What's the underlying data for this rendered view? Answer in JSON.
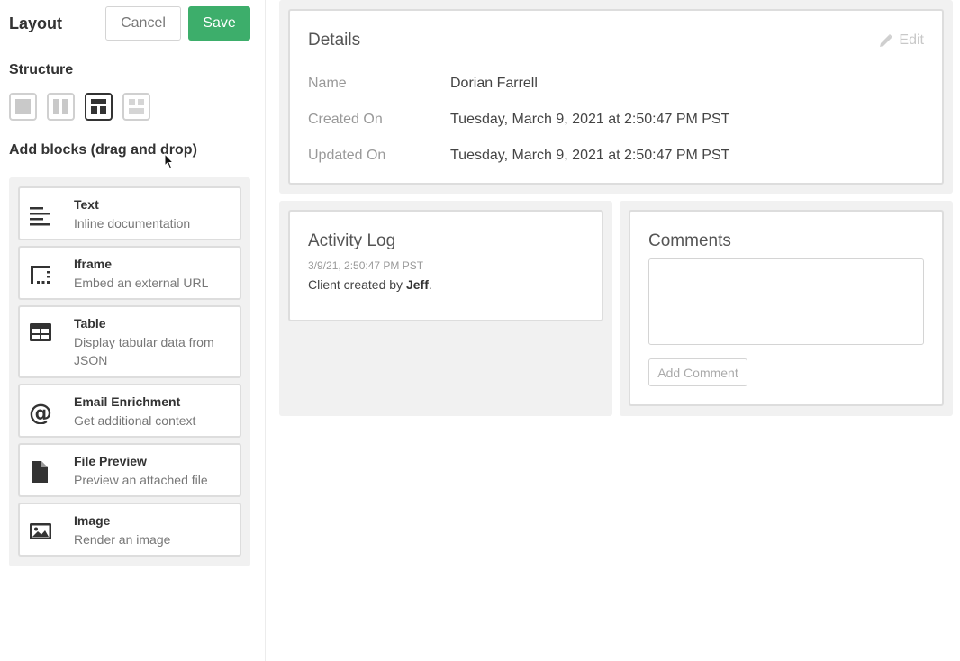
{
  "sidebar": {
    "title": "Layout",
    "cancel_label": "Cancel",
    "save_label": "Save",
    "structure_label": "Structure",
    "structure_options": [
      "single-column",
      "two-columns",
      "header-two-columns",
      "grid"
    ],
    "structure_selected": "header-two-columns",
    "add_blocks_label": "Add blocks (drag and drop)",
    "blocks": [
      {
        "icon": "text-lines-icon",
        "title": "Text",
        "desc": "Inline documentation"
      },
      {
        "icon": "iframe-icon",
        "title": "Iframe",
        "desc": "Embed an external URL"
      },
      {
        "icon": "table-icon",
        "title": "Table",
        "desc": "Display tabular data from JSON"
      },
      {
        "icon": "at-sign-icon",
        "title": "Email Enrichment",
        "desc": "Get additional context"
      },
      {
        "icon": "file-icon",
        "title": "File Preview",
        "desc": "Preview an attached file"
      },
      {
        "icon": "image-icon",
        "title": "Image",
        "desc": "Render an image"
      }
    ]
  },
  "details": {
    "title": "Details",
    "edit_label": "Edit",
    "fields": [
      {
        "label": "Name",
        "value": "Dorian Farrell"
      },
      {
        "label": "Created On",
        "value": "Tuesday, March 9, 2021 at 2:50:47 PM PST"
      },
      {
        "label": "Updated On",
        "value": "Tuesday, March 9, 2021 at 2:50:47 PM PST"
      }
    ]
  },
  "activity": {
    "title": "Activity Log",
    "entries": [
      {
        "time": "3/9/21, 2:50:47 PM PST",
        "text_prefix": "Client created by ",
        "actor": "Jeff",
        "text_suffix": "."
      }
    ]
  },
  "comments": {
    "title": "Comments",
    "input_value": "",
    "button_label": "Add Comment"
  },
  "colors": {
    "accent": "#3dae6b",
    "panel_bg": "#f1f1f1",
    "border": "#dddddd"
  }
}
